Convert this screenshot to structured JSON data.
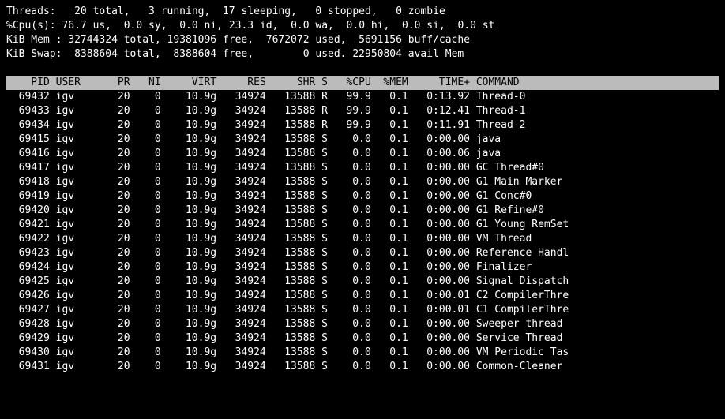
{
  "summary": {
    "threads": {
      "label": "Threads:",
      "total": "20 total,",
      "running": "3 running,",
      "sleeping": "17 sleeping,",
      "stopped": "0 stopped,",
      "zombie": "0 zombie"
    },
    "cpu": {
      "label": "%Cpu(s):",
      "us": "76.7 us,",
      "sy": "0.0 sy,",
      "ni": "0.0 ni,",
      "id": "23.3 id,",
      "wa": "0.0 wa,",
      "hi": "0.0 hi,",
      "si": "0.0 si,",
      "st": "0.0 st"
    },
    "mem": {
      "label": "KiB Mem :",
      "total": "32744324 total,",
      "free": "19381096 free,",
      "used": "7672072 used,",
      "buff": "5691156 buff/cache"
    },
    "swap": {
      "label": "KiB Swap:",
      "total": "8388604 total,",
      "free": "8388604 free,",
      "used": "0 used.",
      "avail": "22950804 avail Mem"
    }
  },
  "columns": [
    "PID",
    "USER",
    "PR",
    "NI",
    "VIRT",
    "RES",
    "SHR",
    "S",
    "%CPU",
    "%MEM",
    "TIME+",
    "COMMAND"
  ],
  "rows": [
    {
      "pid": "69432",
      "user": "igv",
      "pr": "20",
      "ni": "0",
      "virt": "10.9g",
      "res": "34924",
      "shr": "13588",
      "s": "R",
      "cpu": "99.9",
      "mem": "0.1",
      "time": "0:13.92",
      "cmd": "Thread-0"
    },
    {
      "pid": "69433",
      "user": "igv",
      "pr": "20",
      "ni": "0",
      "virt": "10.9g",
      "res": "34924",
      "shr": "13588",
      "s": "R",
      "cpu": "99.9",
      "mem": "0.1",
      "time": "0:12.41",
      "cmd": "Thread-1"
    },
    {
      "pid": "69434",
      "user": "igv",
      "pr": "20",
      "ni": "0",
      "virt": "10.9g",
      "res": "34924",
      "shr": "13588",
      "s": "R",
      "cpu": "99.9",
      "mem": "0.1",
      "time": "0:11.91",
      "cmd": "Thread-2"
    },
    {
      "pid": "69415",
      "user": "igv",
      "pr": "20",
      "ni": "0",
      "virt": "10.9g",
      "res": "34924",
      "shr": "13588",
      "s": "S",
      "cpu": "0.0",
      "mem": "0.1",
      "time": "0:00.00",
      "cmd": "java"
    },
    {
      "pid": "69416",
      "user": "igv",
      "pr": "20",
      "ni": "0",
      "virt": "10.9g",
      "res": "34924",
      "shr": "13588",
      "s": "S",
      "cpu": "0.0",
      "mem": "0.1",
      "time": "0:00.06",
      "cmd": "java"
    },
    {
      "pid": "69417",
      "user": "igv",
      "pr": "20",
      "ni": "0",
      "virt": "10.9g",
      "res": "34924",
      "shr": "13588",
      "s": "S",
      "cpu": "0.0",
      "mem": "0.1",
      "time": "0:00.00",
      "cmd": "GC Thread#0"
    },
    {
      "pid": "69418",
      "user": "igv",
      "pr": "20",
      "ni": "0",
      "virt": "10.9g",
      "res": "34924",
      "shr": "13588",
      "s": "S",
      "cpu": "0.0",
      "mem": "0.1",
      "time": "0:00.00",
      "cmd": "G1 Main Marker"
    },
    {
      "pid": "69419",
      "user": "igv",
      "pr": "20",
      "ni": "0",
      "virt": "10.9g",
      "res": "34924",
      "shr": "13588",
      "s": "S",
      "cpu": "0.0",
      "mem": "0.1",
      "time": "0:00.00",
      "cmd": "G1 Conc#0"
    },
    {
      "pid": "69420",
      "user": "igv",
      "pr": "20",
      "ni": "0",
      "virt": "10.9g",
      "res": "34924",
      "shr": "13588",
      "s": "S",
      "cpu": "0.0",
      "mem": "0.1",
      "time": "0:00.00",
      "cmd": "G1 Refine#0"
    },
    {
      "pid": "69421",
      "user": "igv",
      "pr": "20",
      "ni": "0",
      "virt": "10.9g",
      "res": "34924",
      "shr": "13588",
      "s": "S",
      "cpu": "0.0",
      "mem": "0.1",
      "time": "0:00.00",
      "cmd": "G1 Young RemSet"
    },
    {
      "pid": "69422",
      "user": "igv",
      "pr": "20",
      "ni": "0",
      "virt": "10.9g",
      "res": "34924",
      "shr": "13588",
      "s": "S",
      "cpu": "0.0",
      "mem": "0.1",
      "time": "0:00.00",
      "cmd": "VM Thread"
    },
    {
      "pid": "69423",
      "user": "igv",
      "pr": "20",
      "ni": "0",
      "virt": "10.9g",
      "res": "34924",
      "shr": "13588",
      "s": "S",
      "cpu": "0.0",
      "mem": "0.1",
      "time": "0:00.00",
      "cmd": "Reference Handl"
    },
    {
      "pid": "69424",
      "user": "igv",
      "pr": "20",
      "ni": "0",
      "virt": "10.9g",
      "res": "34924",
      "shr": "13588",
      "s": "S",
      "cpu": "0.0",
      "mem": "0.1",
      "time": "0:00.00",
      "cmd": "Finalizer"
    },
    {
      "pid": "69425",
      "user": "igv",
      "pr": "20",
      "ni": "0",
      "virt": "10.9g",
      "res": "34924",
      "shr": "13588",
      "s": "S",
      "cpu": "0.0",
      "mem": "0.1",
      "time": "0:00.00",
      "cmd": "Signal Dispatch"
    },
    {
      "pid": "69426",
      "user": "igv",
      "pr": "20",
      "ni": "0",
      "virt": "10.9g",
      "res": "34924",
      "shr": "13588",
      "s": "S",
      "cpu": "0.0",
      "mem": "0.1",
      "time": "0:00.01",
      "cmd": "C2 CompilerThre"
    },
    {
      "pid": "69427",
      "user": "igv",
      "pr": "20",
      "ni": "0",
      "virt": "10.9g",
      "res": "34924",
      "shr": "13588",
      "s": "S",
      "cpu": "0.0",
      "mem": "0.1",
      "time": "0:00.01",
      "cmd": "C1 CompilerThre"
    },
    {
      "pid": "69428",
      "user": "igv",
      "pr": "20",
      "ni": "0",
      "virt": "10.9g",
      "res": "34924",
      "shr": "13588",
      "s": "S",
      "cpu": "0.0",
      "mem": "0.1",
      "time": "0:00.00",
      "cmd": "Sweeper thread"
    },
    {
      "pid": "69429",
      "user": "igv",
      "pr": "20",
      "ni": "0",
      "virt": "10.9g",
      "res": "34924",
      "shr": "13588",
      "s": "S",
      "cpu": "0.0",
      "mem": "0.1",
      "time": "0:00.00",
      "cmd": "Service Thread"
    },
    {
      "pid": "69430",
      "user": "igv",
      "pr": "20",
      "ni": "0",
      "virt": "10.9g",
      "res": "34924",
      "shr": "13588",
      "s": "S",
      "cpu": "0.0",
      "mem": "0.1",
      "time": "0:00.00",
      "cmd": "VM Periodic Tas"
    },
    {
      "pid": "69431",
      "user": "igv",
      "pr": "20",
      "ni": "0",
      "virt": "10.9g",
      "res": "34924",
      "shr": "13588",
      "s": "S",
      "cpu": "0.0",
      "mem": "0.1",
      "time": "0:00.00",
      "cmd": "Common-Cleaner"
    }
  ]
}
